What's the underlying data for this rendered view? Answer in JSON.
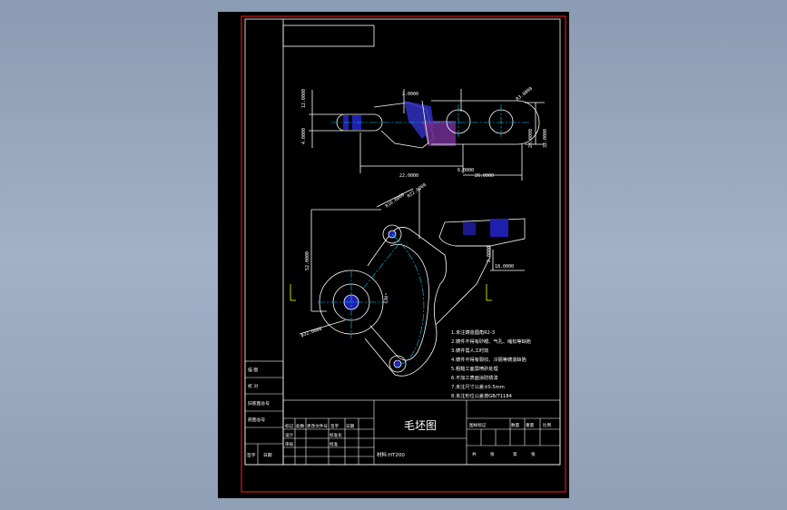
{
  "drawing": {
    "title": "毛坯图",
    "material_field": "材料:HT200",
    "colors": {
      "background": "#000000",
      "border": "#ff2020",
      "lines": "#ffffff",
      "centerline": "#00c8ff",
      "hatch": "#6060ff",
      "hatch_section": "#a040c0",
      "dimension": "#ffffff",
      "marker": "#ffff00"
    },
    "dimensions_top_view": {
      "d1": "12.0000",
      "d2": "4.0000",
      "d3": "22.0000",
      "d4": "26.0000",
      "d5": "2.0000",
      "d6": "20.0000",
      "d7": "32.0000",
      "d8": "R3.0000",
      "d9": "6.0000"
    },
    "dimensions_front_view": {
      "r1": "R10.0000",
      "r2": "R22.0000",
      "h1": "52.0000",
      "h2": "2.0000",
      "h3": "18.0000",
      "phi1": "φ32.0000",
      "a1": "130°"
    },
    "notes": [
      "1.未注铸造圆角R2-3",
      "2.铸件不得有砂眼、气孔、缩松等缺陷",
      "3.铸件需人工时效",
      "4.铸件不得有裂纹、冷隔等铸造缺陷",
      "5.粗糙工面需喷砂处理",
      "6.不加工表面涂防锈漆",
      "7.未注尺寸公差±0.5mm",
      "8.未注形位公差按GB/T1184"
    ],
    "title_block_left": {
      "rows": [
        "描 图",
        "校 对",
        "旧底图总号",
        "底图总号",
        "签字",
        "日期"
      ],
      "header_labels": [
        "标记",
        "处数",
        "更改文件号",
        "签字",
        "日期"
      ],
      "sign_labels": [
        "设计",
        "审核",
        "标准化",
        "批准"
      ]
    },
    "title_block_right": {
      "header_labels": [
        "图样标记",
        "数量",
        "重量",
        "比例"
      ],
      "sheet_labels": [
        "共",
        "张",
        "第",
        "张"
      ]
    }
  }
}
